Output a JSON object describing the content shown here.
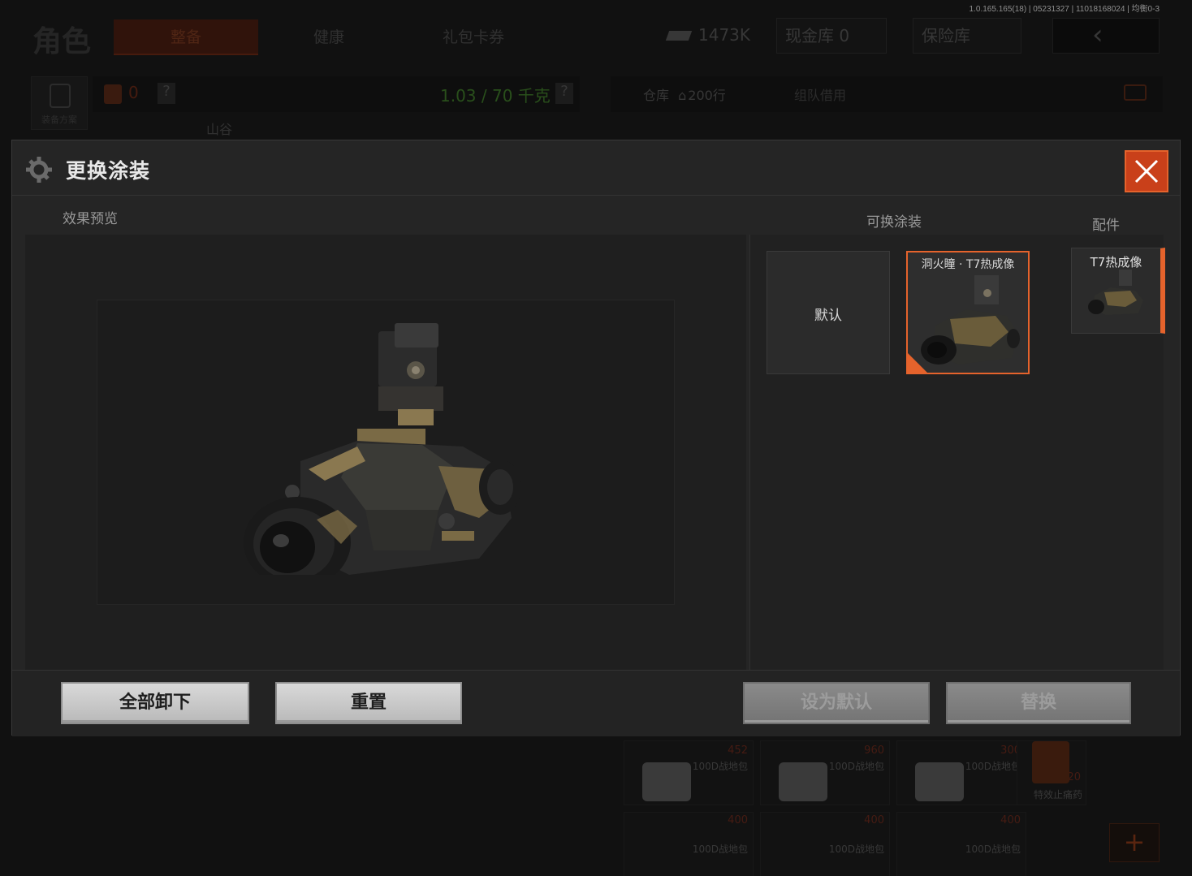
{
  "background": {
    "version": "1.0.165.165(18) | 05231327 | 11018168024 | 均衡0-3",
    "title": "角色",
    "tabs": [
      {
        "label": "整备"
      },
      {
        "label": "健康"
      },
      {
        "label": "礼包卡券"
      }
    ],
    "currency": "1473K",
    "cash_vault": "现金库 0",
    "safe_box": "保险库",
    "loadout_label": "装备方案",
    "armor_count": "0",
    "weight": "1.03 / 70 千克",
    "question": "?",
    "map_label": "山谷",
    "warehouse": "仓库",
    "warehouse_rows": "200行",
    "team_borrow": "组队借用",
    "items": [
      {
        "name": "100D战地包",
        "price": "452",
        "price2": "400"
      },
      {
        "name": "100D战地包",
        "price": "960",
        "price2": "400"
      },
      {
        "name": "100D战地包",
        "price": "300",
        "price2": "400"
      },
      {
        "name": "特效止痛药",
        "price": "220",
        "price2": ""
      }
    ],
    "plus": "+",
    "back_icon": "back-arrow-icon"
  },
  "modal": {
    "title": "更换涂装",
    "preview_label": "效果预览",
    "skins_label": "可换涂装",
    "accessory_label": "配件",
    "skins": [
      {
        "name": "默认",
        "selected": false
      },
      {
        "name": "洞火瞳 · T7热成像",
        "selected": true
      }
    ],
    "accessory": {
      "name": "T7热成像"
    },
    "buttons": {
      "unequip_all": "全部卸下",
      "reset": "重置",
      "set_default": "设为默认",
      "replace": "替换"
    },
    "colors": {
      "accent": "#e5632c",
      "close": "#c9401a",
      "weight_green": "#3f7a2a"
    }
  }
}
